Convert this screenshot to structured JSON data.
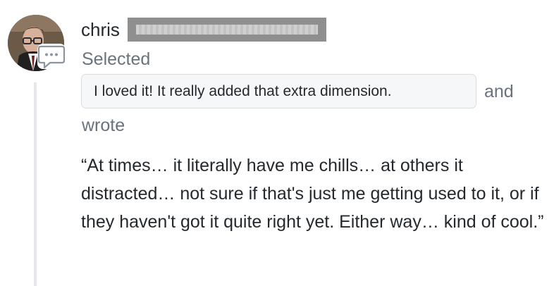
{
  "comment": {
    "user": {
      "name": "chris"
    },
    "action_label": "Selected",
    "selected_choice": "I loved it! It really added that extra dimension.",
    "connector_label": "and",
    "wrote_label": "wrote",
    "text": "“At times… it literally have me chills… at others it distracted… not sure if that's just me getting used to it, or if they haven't got it quite right yet. Either way… kind of cool.”"
  },
  "icons": {
    "avatar": "profile-photo",
    "comment_badge": "speech-bubble-ellipsis-icon"
  },
  "colors": {
    "text_primary": "#24292e",
    "text_secondary": "#6a737d",
    "selected_background": "#f6f7f9",
    "selected_border": "#d9dde2",
    "thread_line": "#e5e7ea",
    "redaction": "#8f8f8f"
  }
}
